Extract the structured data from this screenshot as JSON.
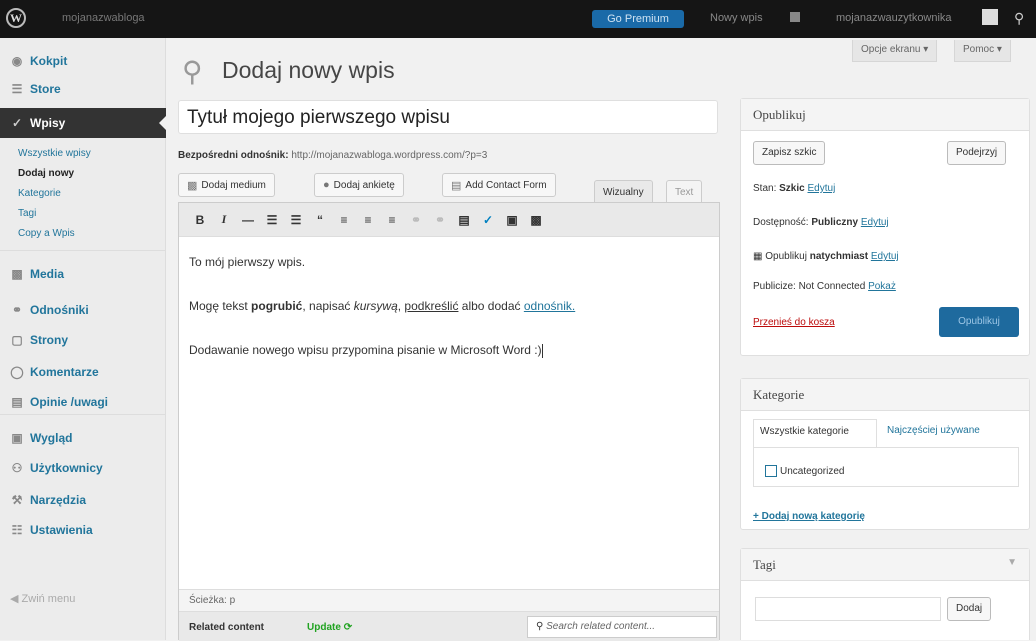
{
  "adminbar": {
    "site": "mojanazwabloga",
    "premium": "Go Premium",
    "new_post": "Nowy wpis",
    "user": "mojanazwauzytkownika",
    "search_icon": "search-icon"
  },
  "sidebar": {
    "items": [
      {
        "label": "Kokpit",
        "icon": "dashboard-icon"
      },
      {
        "label": "Store",
        "icon": "cart-icon"
      },
      {
        "label": "Wpisy",
        "icon": "pin-icon"
      },
      {
        "label": "Media",
        "icon": "media-icon"
      },
      {
        "label": "Odnośniki",
        "icon": "link-icon"
      },
      {
        "label": "Strony",
        "icon": "page-icon"
      },
      {
        "label": "Komentarze",
        "icon": "comment-icon"
      },
      {
        "label": "Opinie /uwagi",
        "icon": "feedback-icon"
      },
      {
        "label": "Wygląd",
        "icon": "appearance-icon"
      },
      {
        "label": "Użytkownicy",
        "icon": "users-icon"
      },
      {
        "label": "Narzędzia",
        "icon": "tools-icon"
      },
      {
        "label": "Ustawienia",
        "icon": "settings-icon"
      }
    ],
    "submenu": [
      "Wszystkie wpisy",
      "Dodaj nowy",
      "Kategorie",
      "Tagi",
      "Copy a Wpis"
    ],
    "collapse": "Zwiń menu"
  },
  "top": {
    "screen_options": "Opcje ekranu ▾",
    "help": "Pomoc ▾"
  },
  "page": {
    "title": "Dodaj nowy wpis"
  },
  "post": {
    "title": "Tytuł mojego pierwszego wpisu",
    "permalink_label": "Bezpośredni odnośnik:",
    "permalink_url": "http://mojanazwabloga.wordpress.com/?p=3"
  },
  "media_buttons": [
    "Dodaj medium",
    "Dodaj ankietę",
    "Add Contact Form"
  ],
  "editor_tabs": {
    "visual": "Wizualny",
    "text": "Text"
  },
  "content": {
    "p1": "To mój pierwszy wpis.",
    "p2_a": "Mogę tekst ",
    "p2_bold": "pogrubić",
    "p2_b": ", napisać ",
    "p2_italic": "kursywą",
    "p2_c": ", ",
    "p2_underline": "podkreślić",
    "p2_d": " albo dodać ",
    "p2_link": "odnośnik.",
    "p3": "Dodawanie nowego wpisu przypomina pisanie w Microsoft Word :)"
  },
  "path": "Ścieżka: p",
  "related": {
    "label": "Related content",
    "update": "Update",
    "search_placeholder": "Search related content..."
  },
  "publish_box": {
    "title": "Opublikuj",
    "save_draft": "Zapisz szkic",
    "preview": "Podejrzyj",
    "status_label": "Stan:",
    "status_value": "Szkic",
    "visibility_label": "Dostępność:",
    "visibility_value": "Publiczny",
    "publish_label": "Opublikuj",
    "publish_value": "natychmiast",
    "edit": "Edytuj",
    "publicize_label": "Publicize: Not Connected",
    "show": "Pokaż",
    "trash": "Przenieś do kosza",
    "publish": "Opublikuj"
  },
  "categories_box": {
    "title": "Kategorie",
    "tab_all": "Wszystkie kategorie",
    "tab_most": "Najczęściej używane",
    "item": "Uncategorized",
    "add": "+ Dodaj nową kategorię"
  },
  "tags_box": {
    "title": "Tagi",
    "add": "Dodaj"
  }
}
